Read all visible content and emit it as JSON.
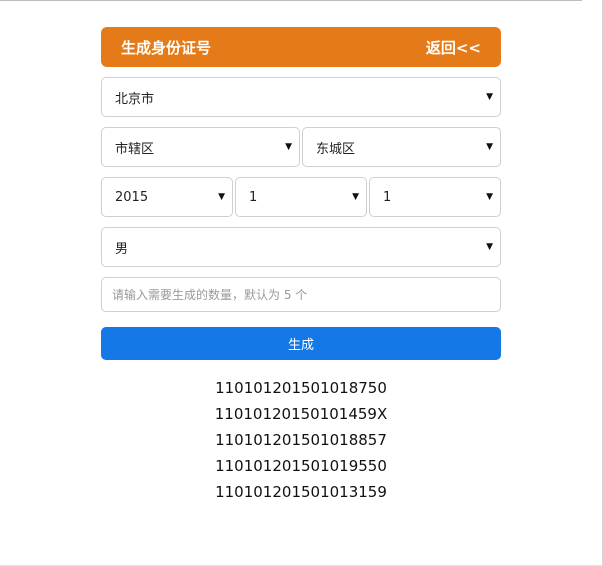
{
  "header": {
    "title": "生成身份证号",
    "back_label": "返回<<",
    "color": "#e47b18"
  },
  "selects": {
    "province": "北京市",
    "city": "市辖区",
    "district": "东城区",
    "year": "2015",
    "month": "1",
    "day": "1",
    "gender": "男"
  },
  "count_input": {
    "value": "",
    "placeholder": "请输入需要生成的数量，默认为 5 个"
  },
  "generate_button": {
    "label": "生成",
    "color": "#1479e6"
  },
  "results": [
    "110101201501018750",
    "11010120150101459X",
    "110101201501018857",
    "110101201501019550",
    "110101201501013159"
  ]
}
